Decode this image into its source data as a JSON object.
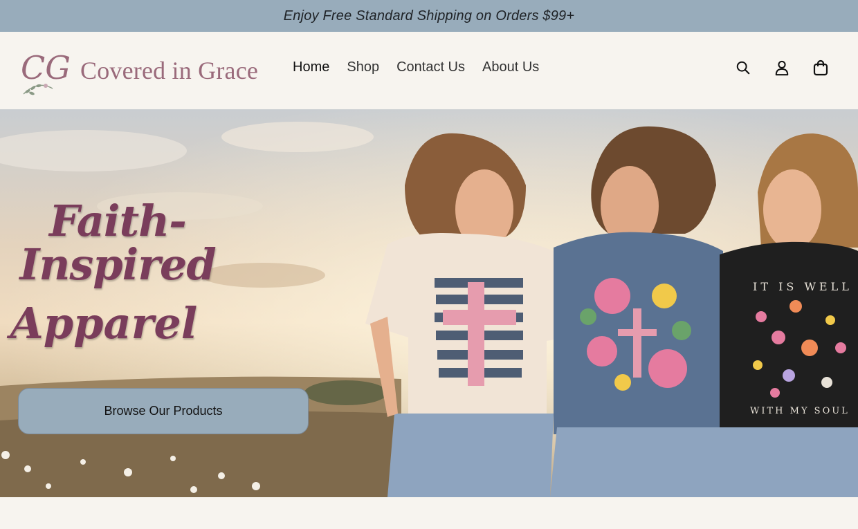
{
  "announcement": "Enjoy Free Standard Shipping on Orders $99+",
  "brand": {
    "name": "Covered in Grace",
    "monogram": "CG"
  },
  "nav": {
    "items": [
      {
        "label": "Home",
        "active": true
      },
      {
        "label": "Shop"
      },
      {
        "label": "Contact Us"
      },
      {
        "label": "About Us"
      }
    ]
  },
  "header_icons": [
    "search-icon",
    "account-icon",
    "cart-icon"
  ],
  "hero": {
    "title_line1": "Faith-Inspired",
    "title_line2": "Apparel",
    "cta_label": "Browse Our Products",
    "shirt_text_top": "IT IS WELL",
    "shirt_text_bottom": "WITH MY SOUL"
  },
  "colors": {
    "announcement_bg": "#98acbb",
    "page_bg": "#f7f4ef",
    "brand_text": "#9a6a7b",
    "hero_title": "#7a3d5b",
    "cta_bg": "#98acbb"
  }
}
